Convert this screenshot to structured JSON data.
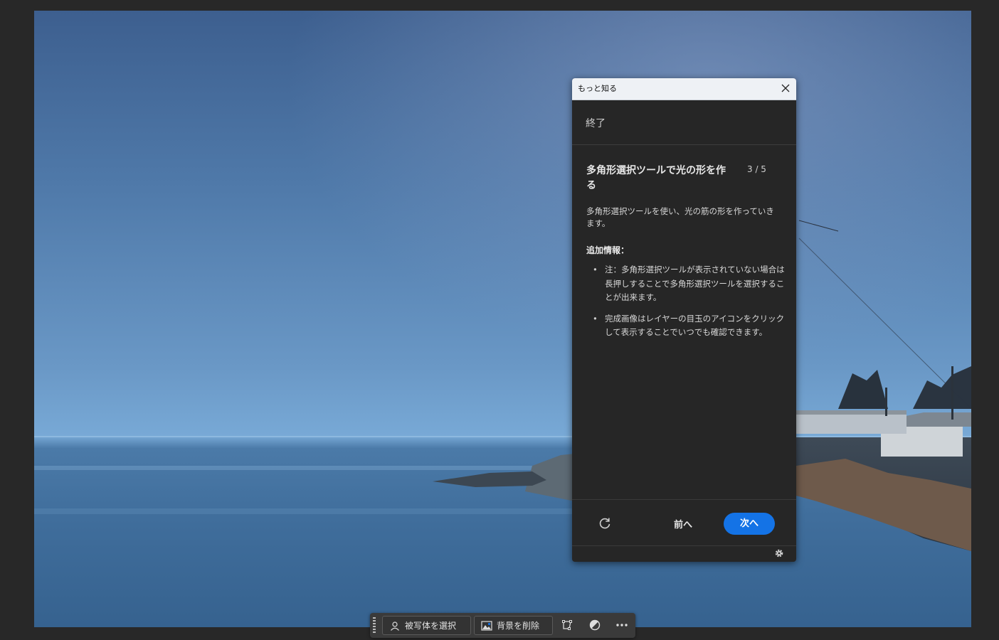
{
  "tutorial_panel": {
    "title": "もっと知る",
    "exit_label": "終了",
    "step_title": "多角形選択ツールで光の形を作る",
    "step_count": "3 / 5",
    "description": "多角形選択ツールを使い、光の筋の形を作っていきます。",
    "info_heading": "追加情報：",
    "bullets": [
      "注：多角形選択ツールが表示されていない場合は長押しすることで多角形選択ツールを選択することが出来ます。",
      "完成画像はレイヤーの目玉のアイコンをクリックして表示することでいつでも確認できます。"
    ],
    "prev_label": "前へ",
    "next_label": "次へ",
    "accent_color": "#1473e6"
  },
  "contextual_taskbar": {
    "select_subject_label": "被写体を選択",
    "remove_background_label": "背景を削除"
  }
}
